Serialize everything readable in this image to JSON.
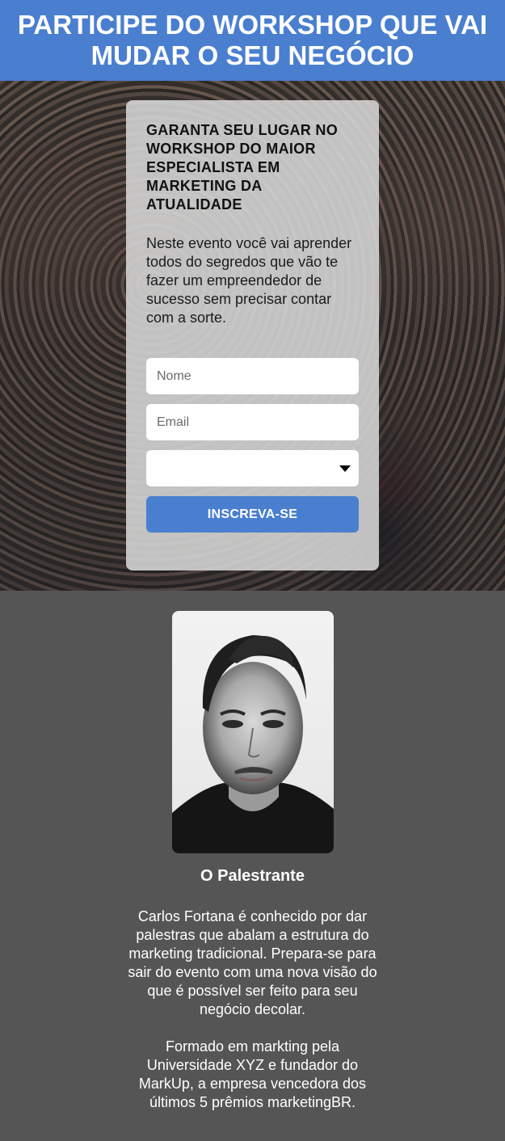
{
  "header": {
    "title": "PARTICIPE DO WORKSHOP QUE VAI MUDAR O SEU NEGÓCIO"
  },
  "form": {
    "heading": "GARANTA SEU LUGAR NO WORKSHOP DO MAIOR ESPECIALISTA EM MARKETING DA ATUALIDADE",
    "description": "Neste evento você vai aprender todos do segredos que vão te fazer um empreendedor de sucesso sem precisar contar com a sorte.",
    "name_placeholder": "Nome",
    "email_placeholder": "Email",
    "select_value": "",
    "submit_label": "INSCREVA-SE"
  },
  "speaker": {
    "title": "O Palestrante",
    "bio_1": "Carlos Fortana é conhecido por dar palestras que abalam a estrutura do marketing tradicional. Prepara-se para sair do evento com uma nova visão do que é possível ser feito para seu negócio decolar.",
    "bio_2": "Formado em markting pela Universidade XYZ e fundador do MarkUp, a empresa vencedora dos últimos 5 prêmios marketingBR."
  },
  "colors": {
    "accent": "#4a7fd0",
    "footer_bg": "#555555"
  }
}
